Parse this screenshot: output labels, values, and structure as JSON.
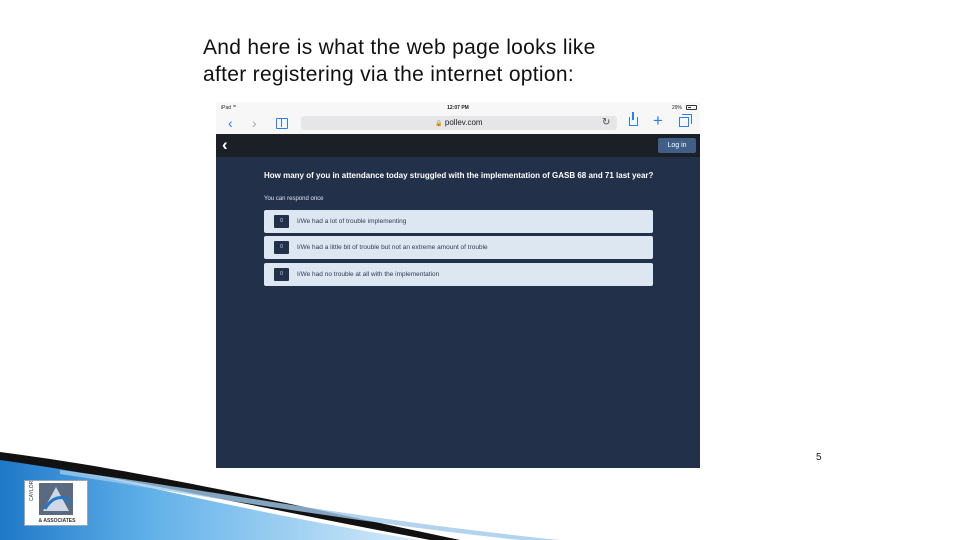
{
  "slide": {
    "title_line1": "And here is what the web page looks like",
    "title_line2": "after registering via the internet option:",
    "page_number": "5",
    "logo_text": "& ASSOCIATES"
  },
  "device": {
    "status": {
      "device": "iPad",
      "time": "12:07 PM",
      "battery": "29%"
    },
    "browser": {
      "url": "pollev.com",
      "icons": [
        "back-icon",
        "forward-icon",
        "bookmarks-icon",
        "lock-icon",
        "reload-icon",
        "share-icon",
        "plus-icon",
        "tabs-icon"
      ]
    }
  },
  "app": {
    "login_label": "Log in",
    "question": "How many of you in attendance today struggled with the implementation of GASB 68 and 71 last year?",
    "note": "You can respond once",
    "options": [
      {
        "count": "0",
        "label": "I/We had a lot of trouble implementing"
      },
      {
        "count": "0",
        "label": "I/We had a little bit of trouble but not an extreme amount of trouble"
      },
      {
        "count": "0",
        "label": "I/We had no trouble at all with the implementation"
      }
    ]
  },
  "colors": {
    "page_bg": "#223049",
    "appbar": "#1b1f26",
    "option_bg": "#dde7f1",
    "login_btn": "#3f5f86",
    "ios_blue": "#2b7cf6"
  }
}
